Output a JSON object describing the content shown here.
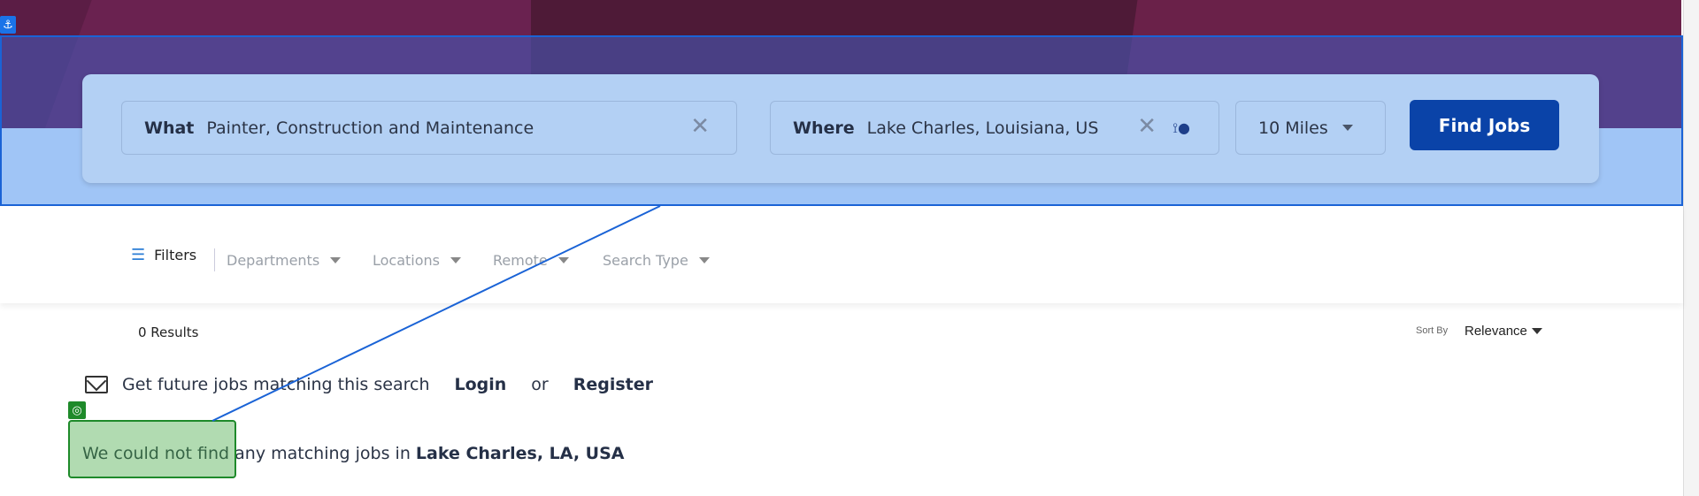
{
  "search": {
    "what_label": "What",
    "what_value": "Painter, Construction and Maintenance",
    "where_label": "Where",
    "where_value": "Lake Charles, Louisiana, US",
    "radius_value": "10 Miles",
    "find_button": "Find Jobs"
  },
  "filters": {
    "label": "Filters",
    "dropdowns": [
      "Departments",
      "Locations",
      "Remote",
      "Search Type"
    ]
  },
  "results": {
    "count_text": "0 Results",
    "sort_label": "Sort By",
    "sort_value": "Relevance"
  },
  "alert": {
    "text": "Get future jobs matching this search",
    "login": "Login",
    "or": "or",
    "register": "Register"
  },
  "no_result": {
    "text": "We could not find any matching jobs in ",
    "location": "Lake Charles, LA, USA"
  },
  "overlay": {
    "anchor_icon": "anchor-icon",
    "target_icon": "target-icon",
    "selection_color": "#1a63d6",
    "highlight_color": "#1e8a2a"
  }
}
